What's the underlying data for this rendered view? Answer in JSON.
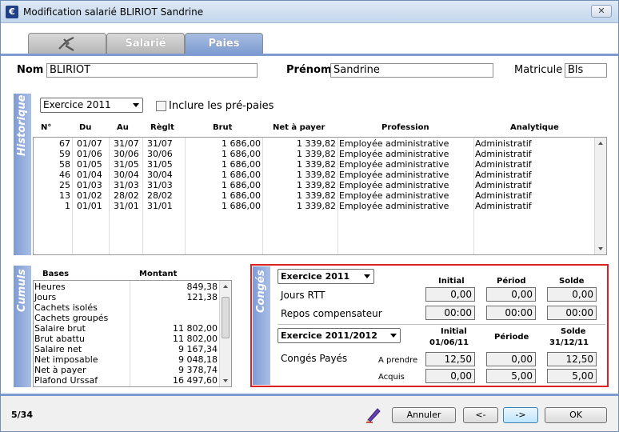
{
  "window": {
    "title": "Modification salarié BLIRIOT Sandrine",
    "close_glyph": "✕",
    "app_icon": "€"
  },
  "tabs": [
    {
      "label": "",
      "icon": "gear-tools-icon"
    },
    {
      "label": "Salarié"
    },
    {
      "label": "Paies"
    }
  ],
  "header": {
    "nom_label": "Nom",
    "nom_value": "BLIRIOT",
    "prenom_label": "Prénom",
    "prenom_value": "Sandrine",
    "matricule_label": "Matricule",
    "matricule_value": "Bls"
  },
  "historique": {
    "band_label": "Historique",
    "exercice": "Exercice 2011",
    "include_label": "Inclure les pré-paies",
    "columns": [
      "N°",
      "Du",
      "Au",
      "Règlt",
      "Brut",
      "Net à payer",
      "Profession",
      "Analytique"
    ],
    "rows": [
      [
        "67",
        "01/07",
        "31/07",
        "31/07",
        "1 686,00",
        "1 339,82",
        "Employée administrative",
        "Administratif"
      ],
      [
        "59",
        "01/06",
        "30/06",
        "30/06",
        "1 686,00",
        "1 339,82",
        "Employée administrative",
        "Administratif"
      ],
      [
        "58",
        "01/05",
        "31/05",
        "31/05",
        "1 686,00",
        "1 339,82",
        "Employée administrative",
        "Administratif"
      ],
      [
        "46",
        "01/04",
        "30/04",
        "30/04",
        "1 686,00",
        "1 339,82",
        "Employée administrative",
        "Administratif"
      ],
      [
        "25",
        "01/03",
        "31/03",
        "31/03",
        "1 686,00",
        "1 339,82",
        "Employée administrative",
        "Administratif"
      ],
      [
        "13",
        "01/02",
        "28/02",
        "28/02",
        "1 686,00",
        "1 339,82",
        "Employée administrative",
        "Administratif"
      ],
      [
        "1",
        "01/01",
        "31/01",
        "31/01",
        "1 686,00",
        "1 339,82",
        "Employée administrative",
        "Administratif"
      ]
    ]
  },
  "cumuls": {
    "band_label": "Cumuls",
    "columns": [
      "Bases",
      "Montant"
    ],
    "rows": [
      [
        "Heures",
        "849,38"
      ],
      [
        "Jours",
        "121,38"
      ],
      [
        "Cachets isolés",
        ""
      ],
      [
        "Cachets groupés",
        ""
      ],
      [
        "Salaire brut",
        "11 802,00"
      ],
      [
        "Brut abattu",
        "11 802,00"
      ],
      [
        "Salaire net",
        "9 167,34"
      ],
      [
        "Net imposable",
        "9 048,18"
      ],
      [
        "Net à payer",
        "9 378,74"
      ],
      [
        "Plafond Urssaf",
        "16 497,60"
      ]
    ]
  },
  "conges": {
    "band_label": "Congés",
    "exercice1": "Exercice 2011",
    "col_initial": "Initial",
    "col_periode": "Périod",
    "col_solde": "Solde",
    "rtt_label": "Jours RTT",
    "rtt": [
      "0,00",
      "0,00",
      "0,00"
    ],
    "repos_label": "Repos compensateur",
    "repos": [
      "00:00",
      "00:00",
      "00:00"
    ],
    "exercice2": "Exercice 2011/2012",
    "col_initial2": "Initial",
    "col_initial2_date": "01/06/11",
    "col_periode2": "Période",
    "col_solde2": "Solde",
    "col_solde2_date": "31/12/11",
    "cp_label": "Congés Payés",
    "aprendre_label": "A prendre",
    "aprendre": [
      "12,50",
      "0,00",
      "12,50"
    ],
    "acquis_label": "Acquis",
    "acquis": [
      "0,00",
      "5,00",
      "5,00"
    ]
  },
  "footer": {
    "counter": "5/34",
    "annuler": "Annuler",
    "prev": "<-",
    "next": "->",
    "ok": "OK"
  }
}
